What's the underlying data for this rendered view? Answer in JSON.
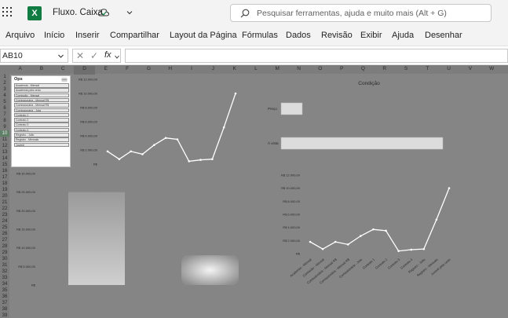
{
  "app": {
    "doc_title": "Fluxo. Caixa",
    "search_placeholder": "Pesquisar ferramentas, ajuda e muito mais (Alt + G)",
    "logo_letter": "X"
  },
  "menu": [
    "Arquivo",
    "Início",
    "Inserir",
    "Compartilhar",
    "Layout da Página",
    "Fórmulas",
    "Dados",
    "Revisão",
    "Exibir",
    "Ajuda",
    "Desenhar"
  ],
  "formula_bar": {
    "name_box": "AB10",
    "cancel_symbol": "✕",
    "enter_symbol": "✓",
    "fx_label": "fx",
    "formula": ""
  },
  "columns": [
    "A",
    "B",
    "C",
    "D",
    "E",
    "F",
    "G",
    "H",
    "I",
    "J",
    "K",
    "L",
    "M",
    "N",
    "O",
    "P",
    "Q",
    "R",
    "S",
    "T",
    "U",
    "V",
    "W"
  ],
  "selected_column": "D",
  "rows": [
    "1",
    "2",
    "3",
    "4",
    "5",
    "6",
    "7",
    "8",
    "9",
    "10",
    "11",
    "12",
    "13",
    "14",
    "15",
    "16",
    "17",
    "18",
    "19",
    "20",
    "21",
    "22",
    "23",
    "24",
    "25",
    "26",
    "27",
    "28",
    "29",
    "30",
    "31",
    "32",
    "33",
    "34",
    "35",
    "36",
    "37",
    "38",
    "39"
  ],
  "selected_row": "10",
  "slicer": {
    "header": "Ops",
    "items": [
      "Academia - Mensal",
      "Academia pela cedu",
      "Comissão - Mensal",
      "Comissionária - Mensal R$",
      "Comissionária - Mensal R$",
      "Comissionária - Jota",
      "Contrato 1",
      "Contrato 2",
      "Contrato 3",
      "Contrato 4",
      "Registro - Julio",
      "Registro - Mensais",
      "Juvenil"
    ]
  },
  "side_form": {
    "condition_title": "Condição",
    "preco_label": "Preço",
    "a_vista_label": "À vista"
  },
  "chart_data": [
    {
      "type": "line",
      "title": "",
      "ylim": [
        0,
        12000
      ],
      "y_ticks": [
        "R$ 12.000,00",
        "R$ 10.000,00",
        "R$ 8.000,00",
        "R$ 6.000,00",
        "R$ 4.000,00",
        "R$ 2.000,00",
        "R$"
      ],
      "values": [
        1800,
        700,
        1800,
        1400,
        2700,
        3700,
        3500,
        400,
        600,
        700,
        5200,
        10000
      ]
    },
    {
      "type": "bar",
      "title": "",
      "ylim": [
        0,
        30000
      ],
      "y_ticks": [
        "R$ 30.000,00",
        "R$ 25.000,00",
        "R$ 20.000,00",
        "R$ 15.000,00",
        "R$ 10.000,00",
        "R$ 5.000,00",
        "R$"
      ],
      "values": [
        25000,
        8000
      ]
    },
    {
      "type": "line",
      "title": "",
      "ylim": [
        0,
        12000
      ],
      "y_ticks": [
        "R$ 12.000,00",
        "R$ 10.000,00",
        "R$ 8.000,00",
        "R$ 6.000,00",
        "R$ 4.000,00",
        "R$ 2.000,00",
        "R$"
      ],
      "categories": [
        "Academia - Mensal",
        "Comissão - Mensal",
        "Comissionária - Mensal R$",
        "Comissionária - Mensal R$",
        "Comissionária - Jota",
        "Contrato 1",
        "Contrato 2",
        "Contrato 3",
        "Contrato 4",
        "Registro - Julio",
        "Registro - Mensais",
        "Juvenil pela cedu"
      ],
      "values": [
        1800,
        700,
        1800,
        1400,
        2700,
        3700,
        3500,
        400,
        600,
        700,
        5200,
        10000
      ]
    }
  ],
  "colors": {
    "excel_green": "#107c41",
    "grid_bg": "#858585",
    "chart_line": "#ffffff"
  }
}
